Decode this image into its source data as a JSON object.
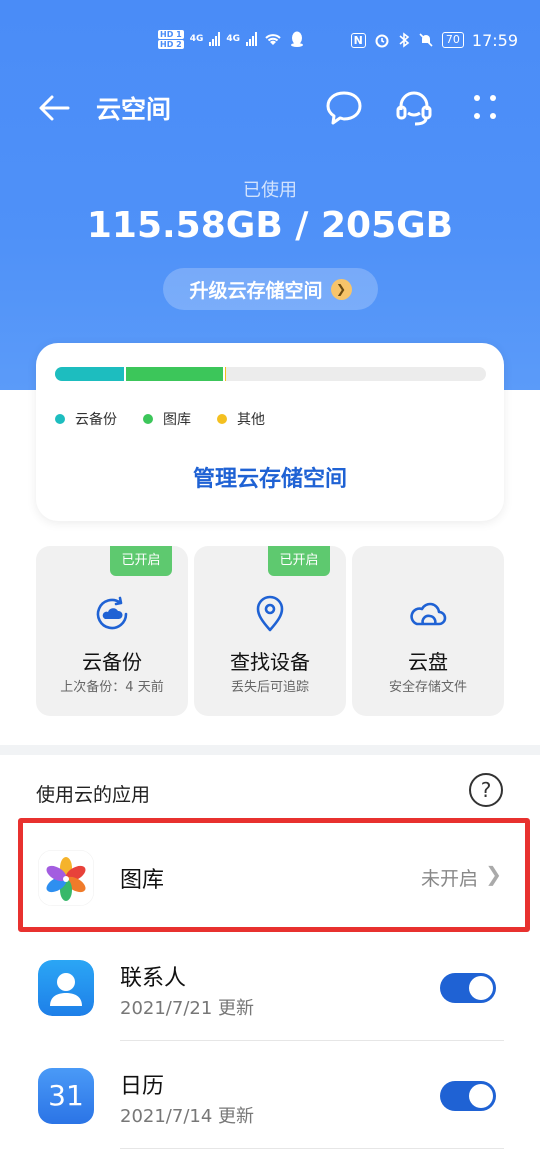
{
  "status_bar": {
    "hd1": "HD 1",
    "hd2": "HD 2",
    "net1": "4G",
    "net2": "4G",
    "nfc": "N",
    "battery": "70",
    "time": "17:59"
  },
  "nav": {
    "title": "云空间"
  },
  "storage": {
    "used_label": "已使用",
    "used_value": "115.58GB / 205GB",
    "upgrade_label": "升级云存储空间",
    "segments": [
      {
        "name": "云备份",
        "fraction": 0.16,
        "color": "#1dbdbf"
      },
      {
        "name": "图库",
        "fraction": 0.23,
        "color": "#3cc65a"
      },
      {
        "name": "其他",
        "fraction": 0.006,
        "color": "#f4c020"
      }
    ],
    "manage_label": "管理云存储空间"
  },
  "tiles": [
    {
      "badge": "已开启",
      "name": "云备份",
      "sub": "上次备份：4 天前",
      "icon": "cloud-backup-icon"
    },
    {
      "badge": "已开启",
      "name": "查找设备",
      "sub": "丢失后可追踪",
      "icon": "location-pin-icon"
    },
    {
      "badge": "",
      "name": "云盘",
      "sub": "安全存储文件",
      "icon": "cloud-drive-icon"
    }
  ],
  "apps_section": {
    "title": "使用云的应用",
    "help": "?",
    "items": [
      {
        "name": "图库",
        "status": "未开启",
        "icon": "gallery-icon"
      },
      {
        "name": "联系人",
        "sub": "2021/7/21 更新",
        "toggle": true,
        "icon": "contacts-icon"
      },
      {
        "name": "日历",
        "sub": "2021/7/14 更新",
        "toggle": true,
        "icon": "calendar-icon",
        "icon_text": "31"
      }
    ]
  },
  "colors": {
    "header_blue": "#4a8cf7",
    "link_blue": "#1f62d4",
    "badge_green": "#5ec96f",
    "highlight_red": "#e8312f"
  }
}
